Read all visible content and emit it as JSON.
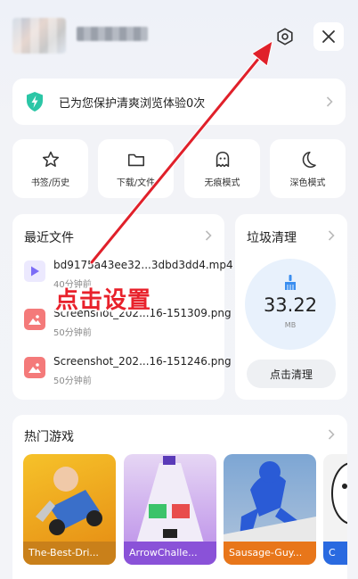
{
  "header": {
    "settings_icon": "settings-hex-icon",
    "close_icon": "close-icon"
  },
  "protect_banner": {
    "text": "已为您保护清爽浏览体验0次",
    "icon": "shield-bolt-icon",
    "accent": "#2bc6a6"
  },
  "quick_actions": [
    {
      "label": "书签/历史",
      "icon": "star-icon"
    },
    {
      "label": "下载/文件",
      "icon": "folder-icon"
    },
    {
      "label": "无痕模式",
      "icon": "ghost-icon"
    },
    {
      "label": "深色模式",
      "icon": "moon-icon"
    }
  ],
  "recent_files": {
    "title": "最近文件",
    "items": [
      {
        "name": "bd9175a43ee32...3dbd3dd4.mp4",
        "time": "40分钟前",
        "type": "video",
        "color": "#7b6cf6"
      },
      {
        "name": "Screenshot_202...16-151309.png",
        "time": "50分钟前",
        "type": "image",
        "color": "#f47a7a"
      },
      {
        "name": "Screenshot_202...16-151246.png",
        "time": "50分钟前",
        "type": "image",
        "color": "#f47a7a"
      }
    ]
  },
  "junk": {
    "title": "垃圾清理",
    "value": "33.22",
    "unit": "MB",
    "button": "点击清理",
    "accent": "#3a8ef0"
  },
  "games": {
    "title": "热门游戏",
    "items": [
      {
        "label": "The-Best-Dri...",
        "color": "#e8a21a",
        "bar": "#c9801a"
      },
      {
        "label": "ArrowChalle...",
        "color": "#b98be8",
        "bar": "#8a52d8"
      },
      {
        "label": "Sausage-Guy...",
        "color": "#7a9ec8",
        "bar": "#e8761a"
      },
      {
        "label": "C",
        "color": "#f3f3f3",
        "bar": "#2a6ae0"
      }
    ]
  },
  "annotation": {
    "text": "点击设置",
    "color": "#e8212b"
  }
}
